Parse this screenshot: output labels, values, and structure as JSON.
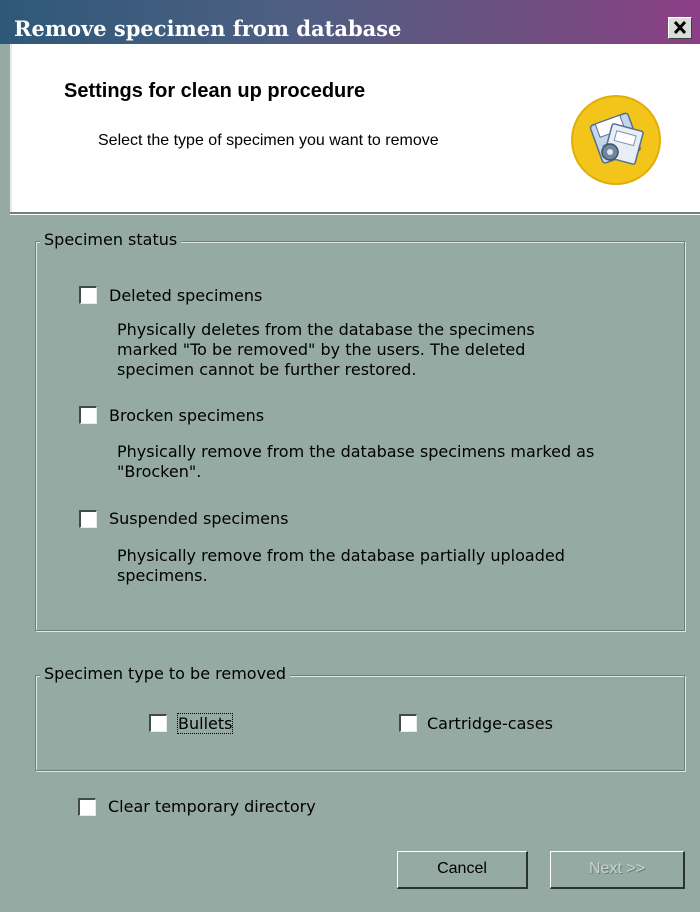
{
  "window": {
    "title": "Remove specimen from database",
    "close_icon": "close-icon"
  },
  "header": {
    "title": "Settings for clean up procedure",
    "subtitle": "Select the type of specimen you want to remove",
    "icon": "wizard-disk-icon"
  },
  "specimen_status": {
    "legend": "Specimen status",
    "items": [
      {
        "label": "Deleted specimens",
        "checked": false,
        "description": "Physically deletes from the database the specimens marked \"To be removed\" by the users. The deleted specimen cannot be further restored."
      },
      {
        "label": "Brocken specimens",
        "checked": false,
        "description": "Physically remove from the database specimens marked as \"Brocken\"."
      },
      {
        "label": "Suspended specimens",
        "checked": false,
        "description": "Physically remove from the database partially uploaded specimens."
      }
    ]
  },
  "specimen_type": {
    "legend": "Specimen type to be removed",
    "items": [
      {
        "label": "Bullets",
        "checked": false
      },
      {
        "label": "Cartridge-cases",
        "checked": false
      }
    ]
  },
  "clear_temp": {
    "label": "Clear temporary directory",
    "checked": false
  },
  "buttons": {
    "cancel": "Cancel",
    "next": "Next >>"
  }
}
